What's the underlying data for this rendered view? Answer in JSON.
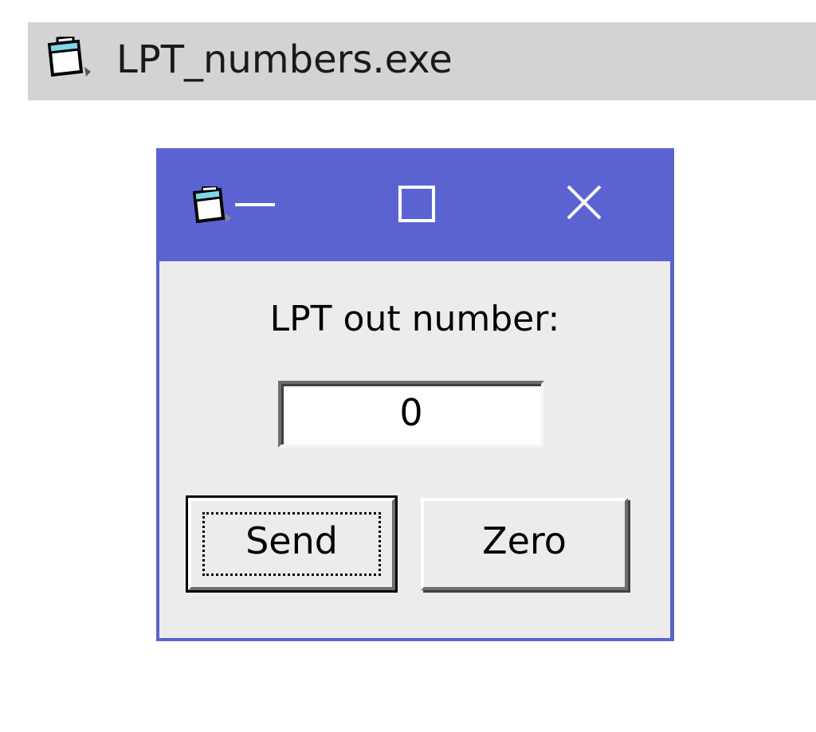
{
  "taskbar": {
    "title": "LPT_numbers.exe",
    "icon": "app-window-icon"
  },
  "window": {
    "icon": "app-window-icon",
    "controls": {
      "minimize": "minimize-icon",
      "maximize": "maximize-icon",
      "close": "close-icon"
    },
    "title_color": "#5b63d3",
    "body": {
      "label": "LPT out number:",
      "value": "0",
      "send_label": "Send",
      "zero_label": "Zero"
    }
  }
}
